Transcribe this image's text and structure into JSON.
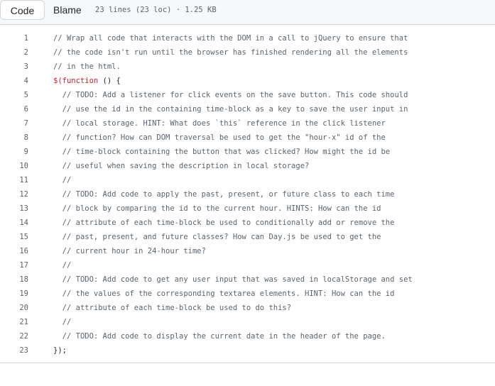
{
  "toolbar": {
    "code_label": "Code",
    "blame_label": "Blame",
    "file_info": "23 lines (23 loc) · 1.25 KB"
  },
  "lines": [
    {
      "n": "1",
      "indent": "",
      "parts": [
        {
          "t": "// Wrap all code that interacts with the DOM in a call to jQuery to ensure that",
          "c": "com"
        }
      ]
    },
    {
      "n": "2",
      "indent": "",
      "parts": [
        {
          "t": "// the code isn't run until the browser has finished rendering all the elements",
          "c": "com"
        }
      ]
    },
    {
      "n": "3",
      "indent": "",
      "parts": [
        {
          "t": "// in the html.",
          "c": "com"
        }
      ]
    },
    {
      "n": "4",
      "indent": "",
      "parts": [
        {
          "t": "$(",
          "c": "kw"
        },
        {
          "t": "function",
          "c": "kw"
        },
        {
          "t": " () {",
          "c": "plain"
        }
      ]
    },
    {
      "n": "5",
      "indent": "  ",
      "parts": [
        {
          "t": "// TODO: Add a listener for click events on the save button. This code should",
          "c": "com"
        }
      ]
    },
    {
      "n": "6",
      "indent": "  ",
      "parts": [
        {
          "t": "// use the id in the containing time-block as a key to save the user input in",
          "c": "com"
        }
      ]
    },
    {
      "n": "7",
      "indent": "  ",
      "parts": [
        {
          "t": "// local storage. HINT: What does `this` reference in the click listener",
          "c": "com"
        }
      ]
    },
    {
      "n": "8",
      "indent": "  ",
      "parts": [
        {
          "t": "// function? How can DOM traversal be used to get the \"hour-x\" id of the",
          "c": "com"
        }
      ]
    },
    {
      "n": "9",
      "indent": "  ",
      "parts": [
        {
          "t": "// time-block containing the button that was clicked? How might the id be",
          "c": "com"
        }
      ]
    },
    {
      "n": "10",
      "indent": "  ",
      "parts": [
        {
          "t": "// useful when saving the description in local storage?",
          "c": "com"
        }
      ]
    },
    {
      "n": "11",
      "indent": "  ",
      "parts": [
        {
          "t": "//",
          "c": "com"
        }
      ]
    },
    {
      "n": "12",
      "indent": "  ",
      "parts": [
        {
          "t": "// TODO: Add code to apply the past, present, or future class to each time",
          "c": "com"
        }
      ]
    },
    {
      "n": "13",
      "indent": "  ",
      "parts": [
        {
          "t": "// block by comparing the id to the current hour. HINTS: How can the id",
          "c": "com"
        }
      ]
    },
    {
      "n": "14",
      "indent": "  ",
      "parts": [
        {
          "t": "// attribute of each time-block be used to conditionally add or remove the",
          "c": "com"
        }
      ]
    },
    {
      "n": "15",
      "indent": "  ",
      "parts": [
        {
          "t": "// past, present, and future classes? How can Day.js be used to get the",
          "c": "com"
        }
      ]
    },
    {
      "n": "16",
      "indent": "  ",
      "parts": [
        {
          "t": "// current hour in 24-hour time?",
          "c": "com"
        }
      ]
    },
    {
      "n": "17",
      "indent": "  ",
      "parts": [
        {
          "t": "//",
          "c": "com"
        }
      ]
    },
    {
      "n": "18",
      "indent": "  ",
      "parts": [
        {
          "t": "// TODO: Add code to get any user input that was saved in localStorage and set",
          "c": "com"
        }
      ]
    },
    {
      "n": "19",
      "indent": "  ",
      "parts": [
        {
          "t": "// the values of the corresponding textarea elements. HINT: How can the id",
          "c": "com"
        }
      ]
    },
    {
      "n": "20",
      "indent": "  ",
      "parts": [
        {
          "t": "// attribute of each time-block be used to do this?",
          "c": "com"
        }
      ]
    },
    {
      "n": "21",
      "indent": "  ",
      "parts": [
        {
          "t": "//",
          "c": "com"
        }
      ]
    },
    {
      "n": "22",
      "indent": "  ",
      "parts": [
        {
          "t": "// TODO: Add code to display the current date in the header of the page.",
          "c": "com"
        }
      ]
    },
    {
      "n": "23",
      "indent": "",
      "parts": [
        {
          "t": "});",
          "c": "plain"
        }
      ]
    }
  ]
}
